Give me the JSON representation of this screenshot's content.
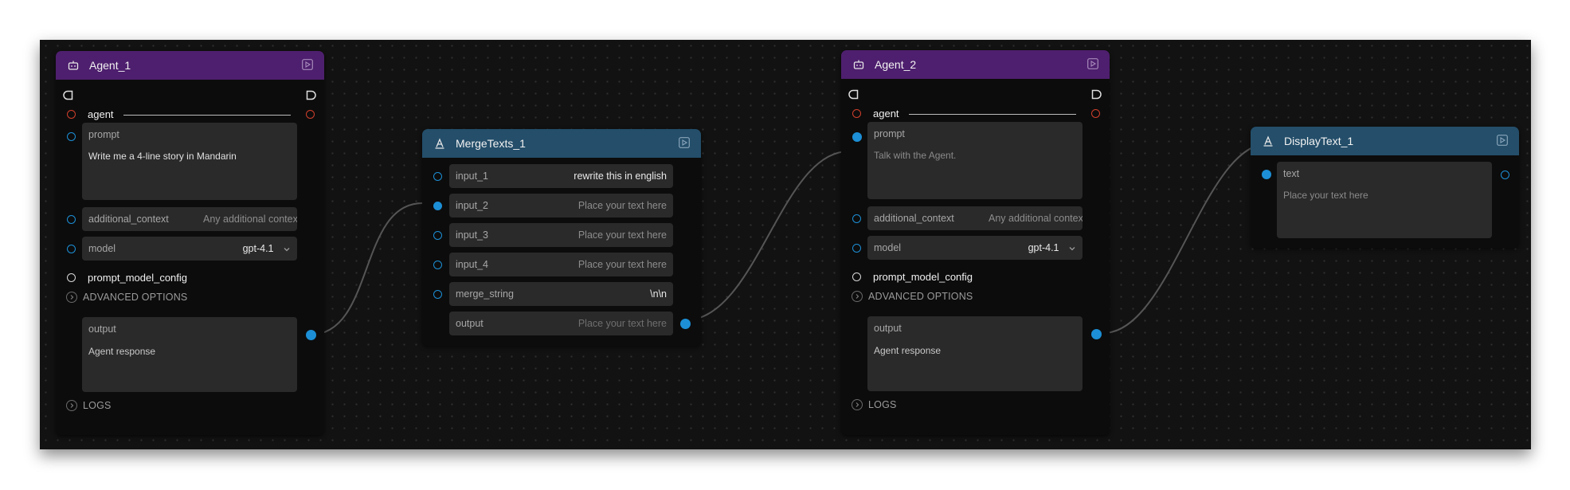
{
  "colors": {
    "agent_header": "#4e1f6e",
    "text_header": "#244e6a",
    "handle_blue": "#1c8fd6",
    "handle_red": "#d0402c",
    "canvas_bg": "#121212",
    "edge": "#555555"
  },
  "icons": {
    "agent_node": "robot-icon",
    "text_node": "text-a-icon",
    "run": "play-square-icon",
    "expand": "chevron-right-circle-icon",
    "select": "chevron-down-icon",
    "flow_handle": "d-shape-icon"
  },
  "agent_1": {
    "title": "Agent_1",
    "agent_label": "agent",
    "prompt_label": "prompt",
    "prompt_value": "Write me a 4-line story in Mandarin",
    "additional_context_label": "additional_context",
    "additional_context_placeholder": "Any additional context fo",
    "model_label": "model",
    "model_value": "gpt-4.1",
    "prompt_model_config_label": "prompt_model_config",
    "advanced_options_label": "ADVANCED OPTIONS",
    "output_label": "output",
    "output_value": "Agent response",
    "logs_label": "LOGS"
  },
  "merge_texts_1": {
    "title": "MergeTexts_1",
    "fields": [
      {
        "label": "input_1",
        "value": "rewrite this in english"
      },
      {
        "label": "input_2",
        "value": "Place your text here"
      },
      {
        "label": "input_3",
        "value": "Place your text here"
      },
      {
        "label": "input_4",
        "value": "Place your text here"
      },
      {
        "label": "merge_string",
        "value": "\\n\\n"
      },
      {
        "label": "output",
        "value": "Place your text here"
      }
    ]
  },
  "agent_2": {
    "title": "Agent_2",
    "agent_label": "agent",
    "prompt_label": "prompt",
    "prompt_value": "Talk with the Agent.",
    "additional_context_label": "additional_context",
    "additional_context_placeholder": "Any additional context fo",
    "model_label": "model",
    "model_value": "gpt-4.1",
    "prompt_model_config_label": "prompt_model_config",
    "advanced_options_label": "ADVANCED OPTIONS",
    "output_label": "output",
    "output_value": "Agent response",
    "logs_label": "LOGS"
  },
  "display_text_1": {
    "title": "DisplayText_1",
    "text_label": "text",
    "text_placeholder": "Place your text here"
  }
}
